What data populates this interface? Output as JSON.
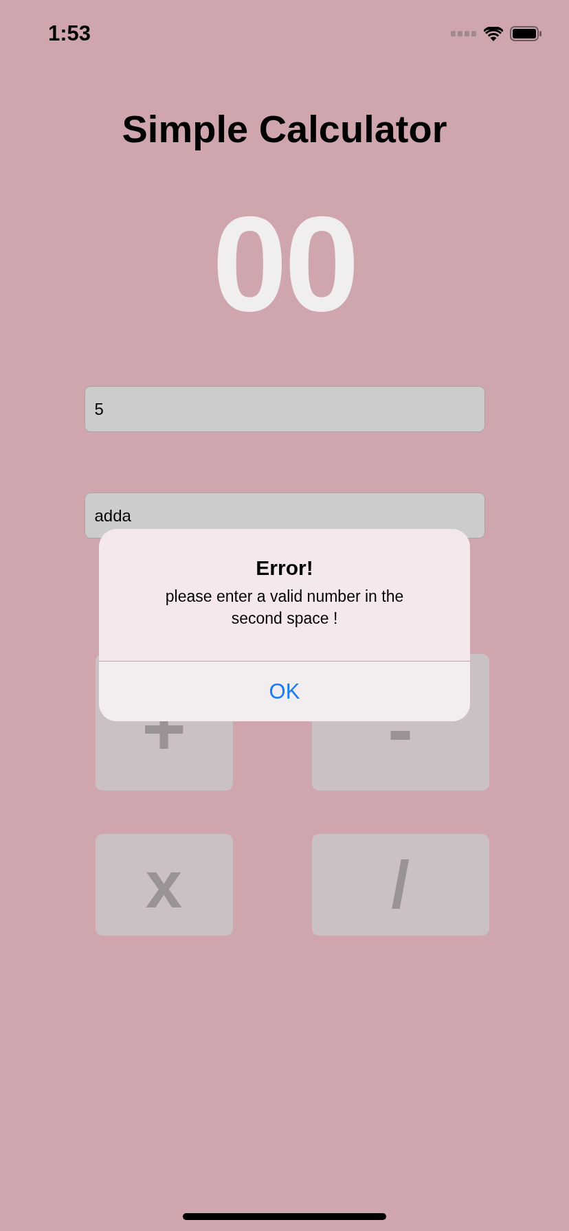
{
  "status_bar": {
    "time": "1:53"
  },
  "title": "Simple Calculator",
  "result": "00",
  "fields": [
    {
      "value": "5"
    },
    {
      "value": "adda"
    }
  ],
  "operations": [
    {
      "label": "+"
    },
    {
      "label": "-"
    },
    {
      "label": "x"
    },
    {
      "label": "/"
    }
  ],
  "alert": {
    "title": "Error!",
    "message": "please enter a valid number in the second space !",
    "buttons": [
      "OK"
    ]
  }
}
